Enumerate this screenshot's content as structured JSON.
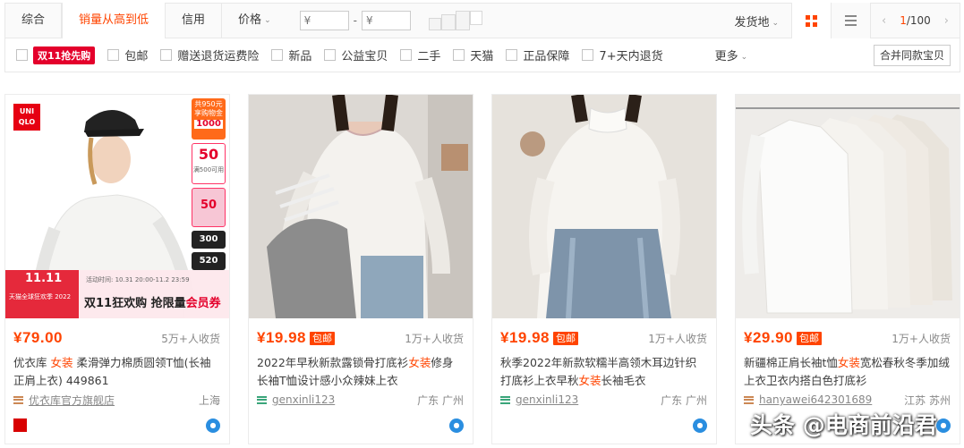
{
  "sortbar": {
    "tabs": [
      {
        "label": "综合"
      },
      {
        "label": "销量从高到低"
      },
      {
        "label": "信用"
      },
      {
        "label": "价格"
      }
    ],
    "price_min_placeholder": "¥",
    "price_max_placeholder": "¥",
    "price_dash": "-",
    "ship_from": "发货地",
    "pager_current": "1",
    "pager_total": "/100"
  },
  "filters": {
    "promo_badge": "双11抢先购",
    "items": [
      "包邮",
      "赠送退货运费险",
      "新品",
      "公益宝贝",
      "二手",
      "天猫",
      "正品保障",
      "7+天内退货"
    ],
    "more": "更多",
    "merge": "合并同款宝贝"
  },
  "products": [
    {
      "price": "¥79.00",
      "free_shipping": "",
      "sold": "5万+人收货",
      "title_pre": "优衣库 ",
      "title_hl": "女装",
      "title_post": " 柔滑弹力棉质圆领T恤(长袖正肩上衣) 449861",
      "shop": "优衣库官方旗舰店",
      "location": "上海",
      "image_overlay": {
        "brand": "UNI QLO",
        "badge_top": "共950元享购物金",
        "badge_1000": "1000",
        "badge_50": "50",
        "badge_50_note": "满500可用",
        "badge_50b": "50",
        "badge_300": "300",
        "badge_520": "520",
        "event_logo": "11.11",
        "event_sub": "天猫全球狂欢季 2022",
        "event_time": "活动时间: 10.31 20:00-11.2 23:59",
        "event_headline_pre": "双11狂欢购 抢限量",
        "event_headline_hl": "会员券"
      }
    },
    {
      "price": "¥19.98",
      "free_shipping": "包邮",
      "sold": "1万+人收货",
      "title_pre": "2022年早秋新款露锁骨打底衫",
      "title_hl": "女装",
      "title_post": "修身长袖T恤设计感小众辣妹上衣",
      "shop": "genxinli123",
      "location": "广东 广州"
    },
    {
      "price": "¥19.98",
      "free_shipping": "包邮",
      "sold": "1万+人收货",
      "title_pre": "秋季2022年新款软糯半高领木耳边针织打底衫上衣早秋",
      "title_hl": "女装",
      "title_post": "长袖毛衣",
      "shop": "genxinli123",
      "location": "广东 广州"
    },
    {
      "price": "¥29.90",
      "free_shipping": "包邮",
      "sold": "1万+人收货",
      "title_pre": "新疆棉正肩长袖t恤",
      "title_hl": "女装",
      "title_post": "宽松春秋冬季加绒上衣卫衣内搭白色打底衫",
      "shop": "hanyawei642301689",
      "location": "江苏 苏州"
    }
  ],
  "watermark": "头条 @电商前沿君",
  "colors": {
    "accent": "#ff4400",
    "promo_red": "#e4002b"
  }
}
